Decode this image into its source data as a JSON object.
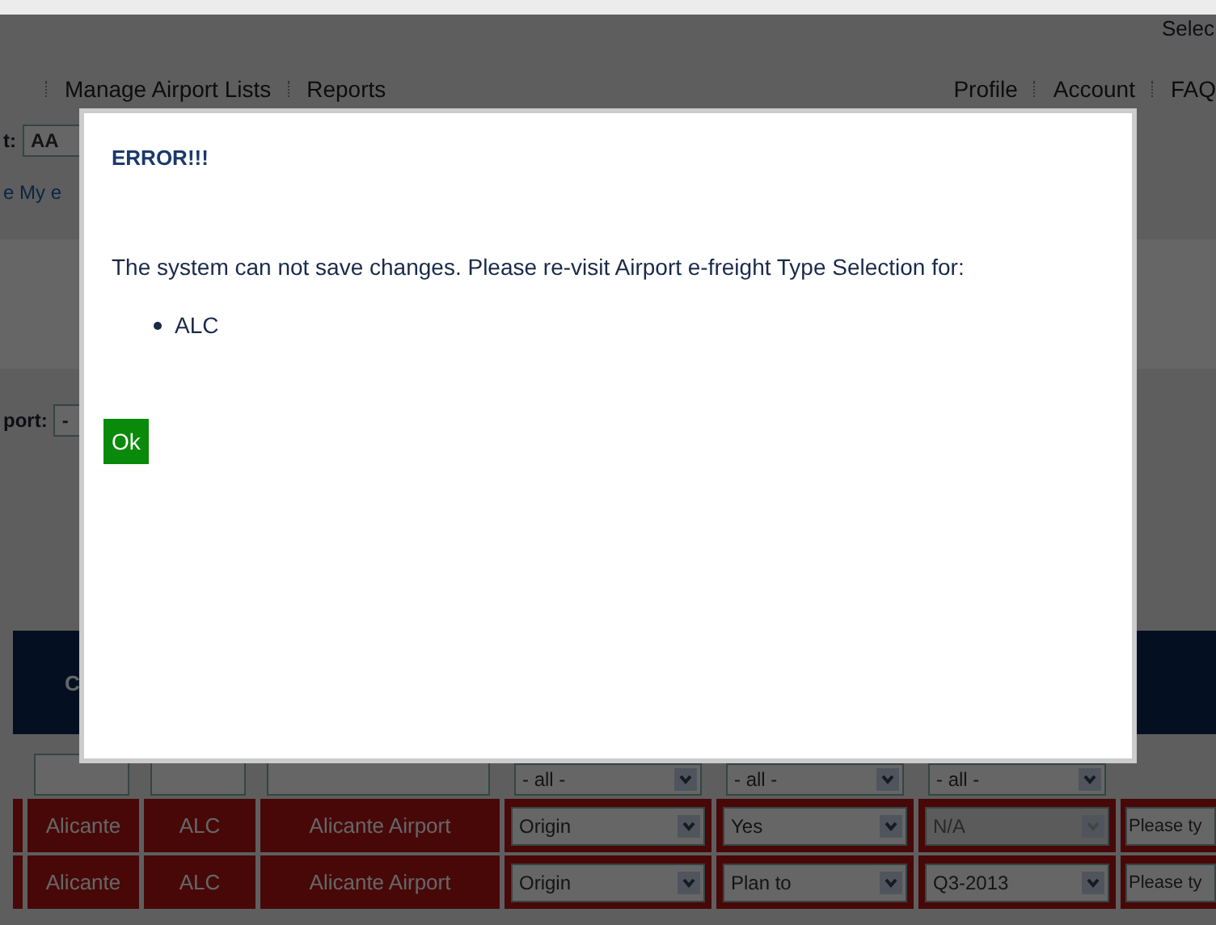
{
  "header": {
    "corner_text": "Selec",
    "nav_left": [
      "Manage Airport Lists",
      "Reports"
    ],
    "nav_right": [
      "Profile",
      "Account",
      "FAQ"
    ]
  },
  "filters": {
    "label_1": "t:",
    "select_1": "AA",
    "link": "e My e",
    "label_2": "port:",
    "select_2": "-"
  },
  "table": {
    "column_1": "C",
    "filter_row": [
      {
        "kind": "input"
      },
      {
        "kind": "input"
      },
      {
        "kind": "input"
      },
      {
        "kind": "select",
        "value": "- all -"
      },
      {
        "kind": "select",
        "value": "- all -"
      },
      {
        "kind": "select",
        "value": "- all -"
      }
    ],
    "rows": [
      {
        "cells": [
          {
            "kind": "text",
            "value": "Alicante"
          },
          {
            "kind": "text",
            "value": "ALC"
          },
          {
            "kind": "text",
            "value": "Alicante Airport"
          },
          {
            "kind": "select",
            "value": "Origin",
            "disabled": false
          },
          {
            "kind": "select",
            "value": "Yes",
            "disabled": false
          },
          {
            "kind": "select",
            "value": "N/A",
            "disabled": true
          },
          {
            "kind": "input",
            "placeholder": "Please ty"
          }
        ]
      },
      {
        "cells": [
          {
            "kind": "text",
            "value": "Alicante"
          },
          {
            "kind": "text",
            "value": "ALC"
          },
          {
            "kind": "text",
            "value": "Alicante Airport"
          },
          {
            "kind": "select",
            "value": "Origin",
            "disabled": false
          },
          {
            "kind": "select",
            "value": "Plan to",
            "disabled": false
          },
          {
            "kind": "select",
            "value": "Q3-2013",
            "disabled": false
          },
          {
            "kind": "input",
            "placeholder": "Please ty"
          }
        ]
      }
    ]
  },
  "dialog": {
    "title": "ERROR!!!",
    "message": "The system can not save changes. Please re-visit Airport e-freight Type Selection for:",
    "items": [
      "ALC"
    ],
    "button": "Ok"
  }
}
